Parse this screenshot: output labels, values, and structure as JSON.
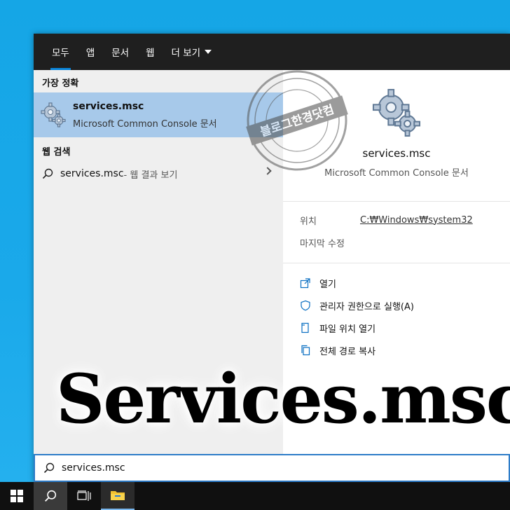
{
  "tabs": [
    {
      "label": "모두"
    },
    {
      "label": "앱"
    },
    {
      "label": "문서"
    },
    {
      "label": "웹"
    },
    {
      "label": "더 보기"
    }
  ],
  "results": {
    "best_match_label": "가장 정확",
    "best_match": {
      "title": "services.msc",
      "subtitle": "Microsoft Common Console 문서"
    },
    "web_label": "웹 검색",
    "web_item": {
      "query": "services.msc",
      "suffix": " - 웹 결과 보기"
    }
  },
  "detail": {
    "title": "services.msc",
    "subtitle": "Microsoft Common Console 문서",
    "location_label": "위치",
    "location_value": "C:₩Windows₩system32",
    "modified_label": "마지막 수정",
    "actions": [
      {
        "label": "열기",
        "icon": "open-icon"
      },
      {
        "label": "관리자 권한으로 실행(A)",
        "icon": "shield-icon"
      },
      {
        "label": "파일 위치 열기",
        "icon": "file-location-icon"
      },
      {
        "label": "전체 경로 복사",
        "icon": "copy-icon"
      }
    ]
  },
  "overlay_title": "Services.msc",
  "watermark": "블로그한경닷컴",
  "search": {
    "value": "services.msc"
  },
  "colors": {
    "accent": "#0a84d8",
    "selection": "#a7c9ea",
    "tabbar": "#1f1f1f",
    "taskbar": "#101010"
  }
}
